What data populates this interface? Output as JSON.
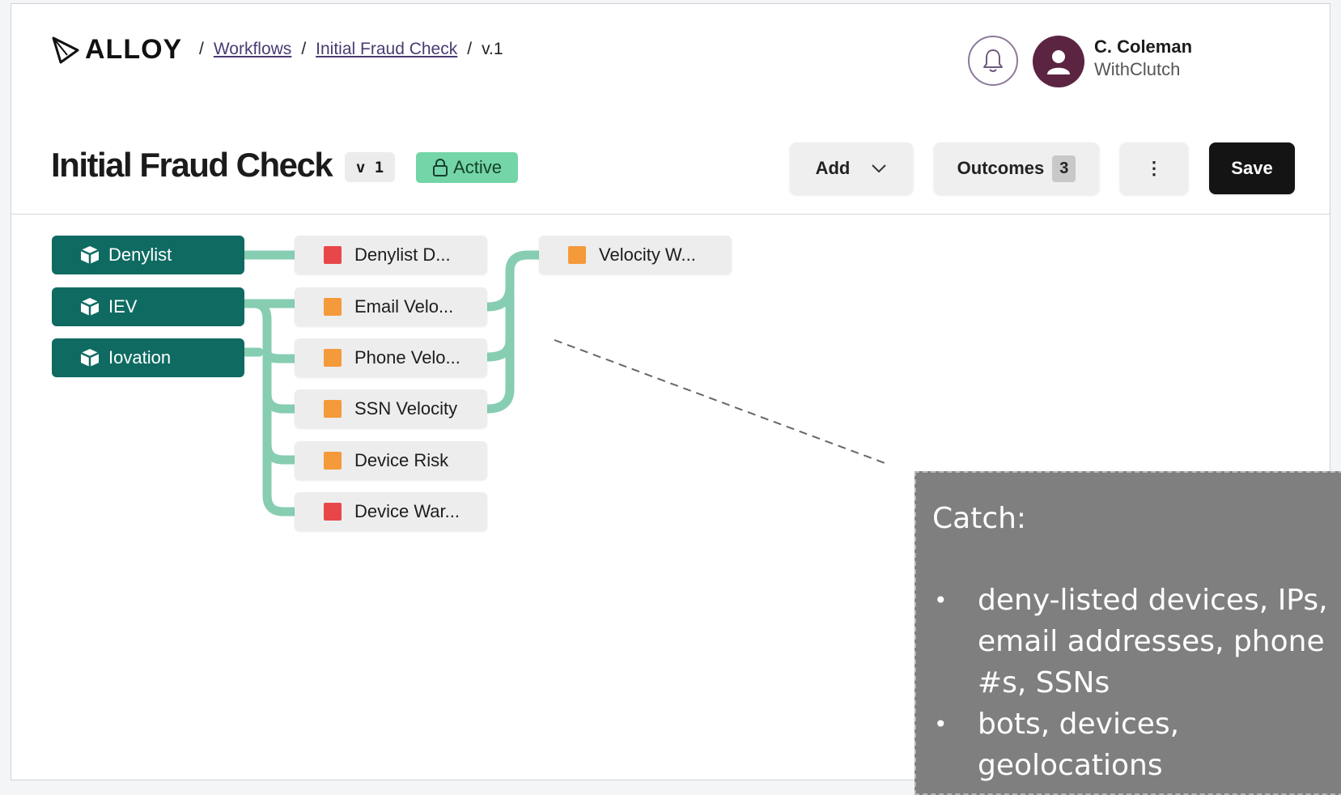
{
  "brand": {
    "logo_text": "ALLOY"
  },
  "breadcrumb": {
    "sep": "/",
    "items": [
      "Workflows",
      "Initial Fraud Check"
    ],
    "current": "v.1"
  },
  "user": {
    "name": "C. Coleman",
    "org": "WithClutch"
  },
  "header": {
    "title": "Initial Fraud Check",
    "version": "v 1",
    "status": "Active",
    "add_label": "Add",
    "outcomes_label": "Outcomes",
    "outcomes_count": "3",
    "more_label": "⋮",
    "save_label": "Save"
  },
  "flow": {
    "sources": [
      "Denylist",
      "IEV",
      "Iovation"
    ],
    "rules": [
      {
        "label": "Denylist D...",
        "color": "#e8474a"
      },
      {
        "label": "Email Velo...",
        "color": "#f49a3b"
      },
      {
        "label": "Phone Velo...",
        "color": "#f49a3b"
      },
      {
        "label": "SSN Velocity",
        "color": "#f49a3b"
      },
      {
        "label": "Device Risk",
        "color": "#f49a3b"
      },
      {
        "label": "Device War...",
        "color": "#e8474a"
      }
    ],
    "outcome_nodes": [
      {
        "label": "Velocity W...",
        "color": "#f49a3b"
      }
    ]
  },
  "callout": {
    "heading": "Catch:",
    "bullets": [
      "deny-listed devices, IPs, email addresses, phone #s, SSNs",
      "bots, devices, geolocations"
    ]
  },
  "colors": {
    "accent": "#0f6b62",
    "link": "#86cdb1",
    "active": "#74d5a8"
  }
}
